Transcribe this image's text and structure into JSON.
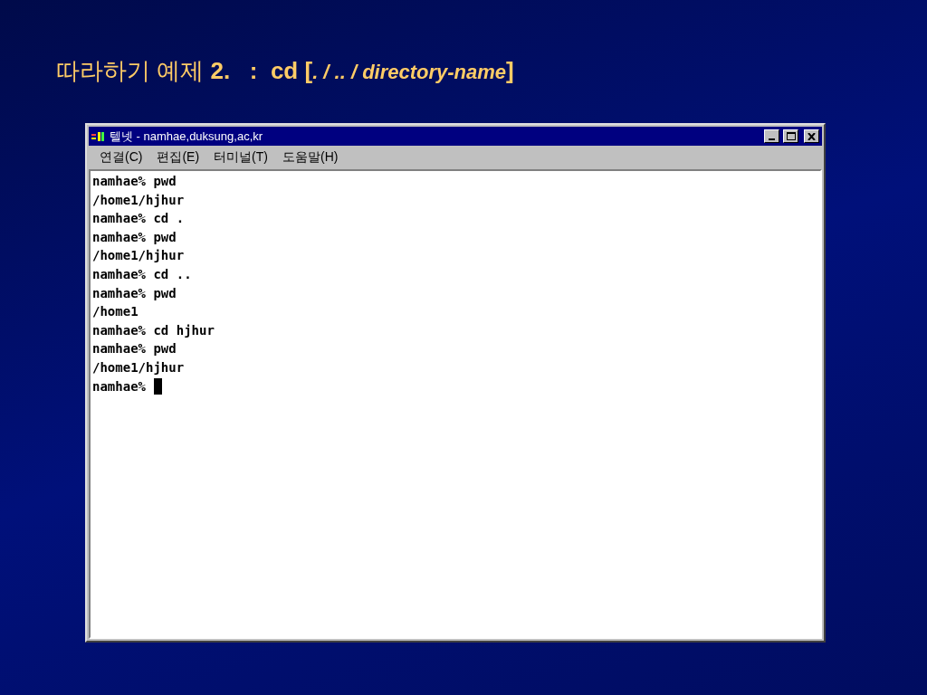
{
  "slide": {
    "title": [
      {
        "kind": "plain",
        "text": "따라하기 예제 "
      },
      {
        "kind": "bold",
        "text": "2.   :  cd ["
      },
      {
        "kind": "italic",
        "text": ". / .. / directory-name"
      },
      {
        "kind": "bold",
        "text": "]"
      }
    ]
  },
  "window": {
    "title": "텔넷 - namhae,duksung,ac,kr",
    "controls": [
      {
        "kind": "minimize"
      },
      {
        "kind": "maximize"
      },
      {
        "kind": "close"
      }
    ]
  },
  "menu": [
    "연결(C)",
    "편집(E)",
    "터미널(T)",
    "도움말(H)"
  ],
  "terminal": {
    "lines": [
      "namhae% pwd",
      "/home1/hjhur",
      "namhae% cd .",
      "namhae% pwd",
      "/home1/hjhur",
      "namhae% cd ..",
      "namhae% pwd",
      "/home1",
      "namhae% cd hjhur",
      "namhae% pwd",
      "/home1/hjhur"
    ],
    "prompt": "namhae%",
    "cursor": true
  }
}
